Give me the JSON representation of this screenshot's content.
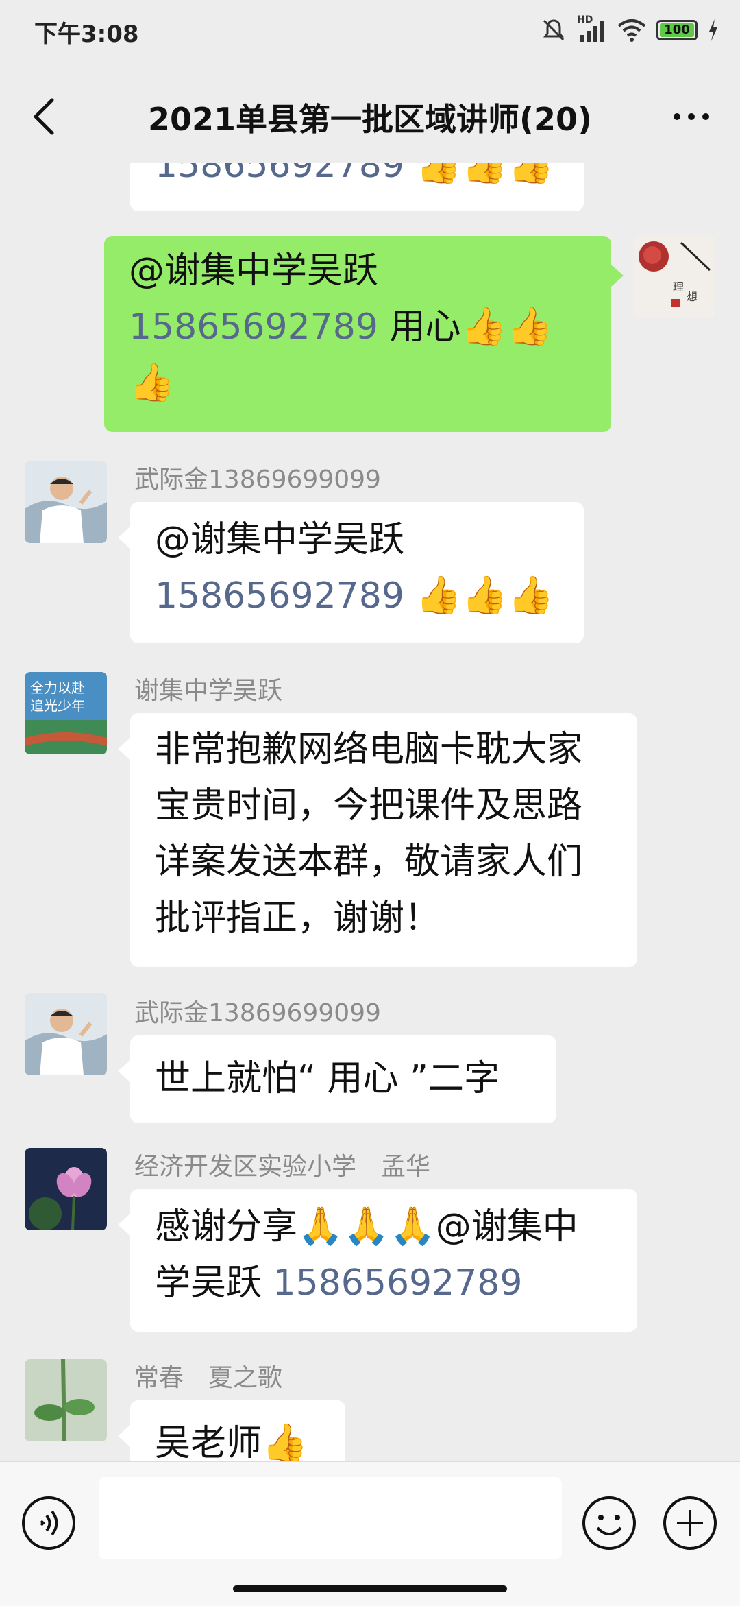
{
  "status_bar": {
    "time": "下午3:08",
    "battery": "100",
    "network": "HD"
  },
  "header": {
    "title": "2021单县第一批区域讲师(20)",
    "back_icon": "chevron-left-icon",
    "more_icon": "more-dots-icon"
  },
  "messages": [
    {
      "id": "m0",
      "type": "received",
      "partial": true,
      "link": "15865692789",
      "emoji": "👍👍👍"
    },
    {
      "id": "m1",
      "type": "sent",
      "line1": "@谢集中学吴跃",
      "link": "15865692789",
      "text": "  用心",
      "emoji": "👍👍",
      "line3_emoji": "👍"
    },
    {
      "id": "m2",
      "type": "received",
      "sender": "武际金13869699099",
      "line1": "@谢集中学吴跃",
      "link": "15865692789",
      "emoji": "👍👍👍"
    },
    {
      "id": "m3",
      "type": "received",
      "sender": "谢集中学吴跃",
      "lines": [
        "非常抱歉网络电脑卡耽大家",
        "宝贵时间，今把课件及思路",
        "详案发送本群，敬请家人们",
        "批评指正，谢谢！"
      ]
    },
    {
      "id": "m4",
      "type": "received",
      "sender": "武际金13869699099",
      "text": "世上就怕“ 用心 ”二字"
    },
    {
      "id": "m5",
      "type": "received",
      "sender": "经济开发区实验小学　孟华",
      "line1_text": "感谢分享",
      "line1_emoji": "🙏🙏🙏",
      "line1_tail": "@谢集中",
      "line2_text": "学吴跃 ",
      "link": "15865692789"
    },
    {
      "id": "m6",
      "type": "received",
      "partial": true,
      "sender": "常春　夏之歌",
      "text": "吴老师",
      "emoji": "👍"
    }
  ],
  "input": {
    "placeholder": ""
  },
  "icons": {
    "voice": "voice-icon",
    "emoji": "smiley-icon",
    "plus": "plus-icon"
  },
  "colors": {
    "background": "#ededed",
    "sent_bubble": "#95ec69",
    "received_bubble": "#ffffff",
    "link": "#56688c",
    "sender_name": "#8a8a8a"
  }
}
